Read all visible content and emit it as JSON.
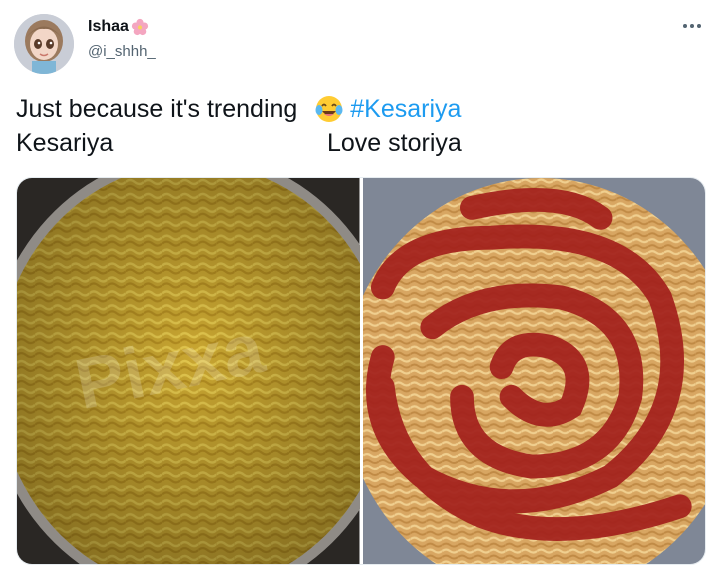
{
  "author": {
    "display_name": "Ishaa",
    "handle": "@i_shhh_",
    "name_icon": "cherry-blossom-icon",
    "avatar_icon": "avatar-doll-icon"
  },
  "tweet": {
    "line1_text": "Just because it's trending ",
    "emoji": "face-with-tears-of-joy-emoji",
    "hashtag": "#Kesariya",
    "line2_left": "Kesariya",
    "line2_right": "Love storiya"
  },
  "media": {
    "left_image": "plain-yellow-noodles-in-steel-bowl",
    "left_watermark": "Pixxa",
    "right_image": "noodles-with-ketchup-heart-swirl"
  },
  "colors": {
    "hashtag": "#1d9bf0",
    "handle": "#536471",
    "text": "#0f1419"
  }
}
